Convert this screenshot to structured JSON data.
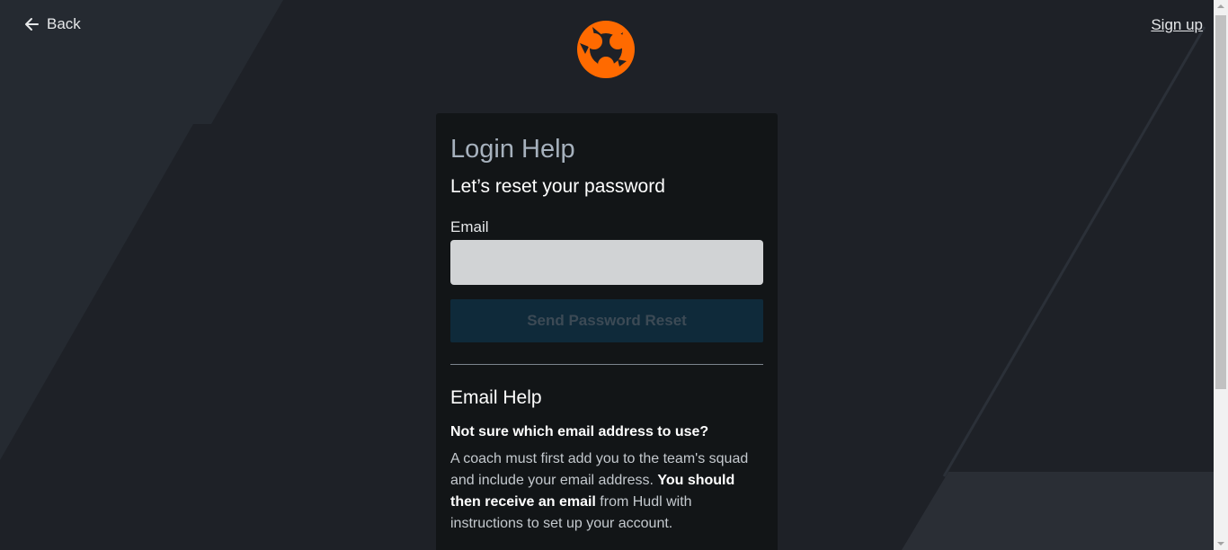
{
  "nav": {
    "back_label": "Back",
    "signup_label": "Sign up"
  },
  "brand": {
    "logo_icon": "hudl-logo-icon",
    "accent_color": "#ff6a00"
  },
  "card": {
    "title": "Login Help",
    "subtitle": "Let’s reset your password",
    "email_label": "Email",
    "email_value": "",
    "send_button_label": "Send Password Reset",
    "email_help_heading": "Email Help",
    "question": "Not sure which email address to use?",
    "help_part1": "A coach must first add you to the team's squad and include your email address. ",
    "help_bold": "You should then receive an email",
    "help_part2": " from Hudl with instructions to set up your account."
  }
}
